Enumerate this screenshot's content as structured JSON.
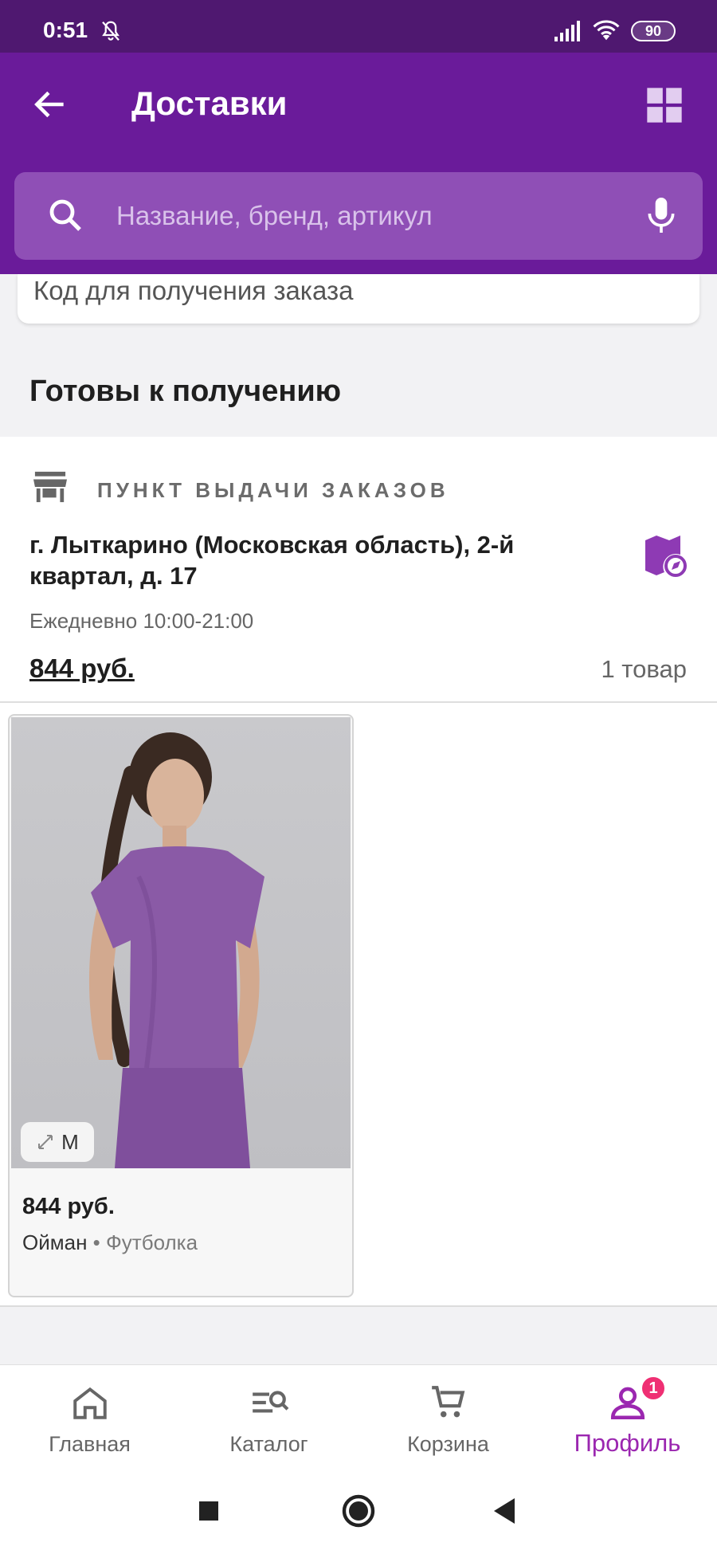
{
  "status_bar": {
    "time": "0:51",
    "battery": "90"
  },
  "header": {
    "title": "Доставки"
  },
  "search": {
    "placeholder": "Название, бренд, артикул"
  },
  "code_card": {
    "label": "Код для получения заказа"
  },
  "section": {
    "title": "Готовы к получению"
  },
  "delivery": {
    "point_type": "ПУНКТ ВЫДАЧИ ЗАКАЗОВ",
    "address": "г. Лыткарино (Московская область), 2-й квартал, д. 17",
    "hours": "Ежедневно 10:00-21:00",
    "total": "844 руб.",
    "item_count": "1 товар"
  },
  "product": {
    "size": "M",
    "price": "844 руб.",
    "brand": "Ойман",
    "separator": " • ",
    "category": "Футболка"
  },
  "bottom_nav": {
    "items": [
      {
        "label": "Главная",
        "icon": "home-icon"
      },
      {
        "label": "Каталог",
        "icon": "catalog-search-icon"
      },
      {
        "label": "Корзина",
        "icon": "cart-icon"
      },
      {
        "label": "Профиль",
        "icon": "profile-icon",
        "badge": "1"
      }
    ]
  },
  "colors": {
    "primary": "#6a1b9a",
    "status_bar": "#4f1870",
    "accent": "#9b27b0",
    "badge": "#ef2f73"
  }
}
